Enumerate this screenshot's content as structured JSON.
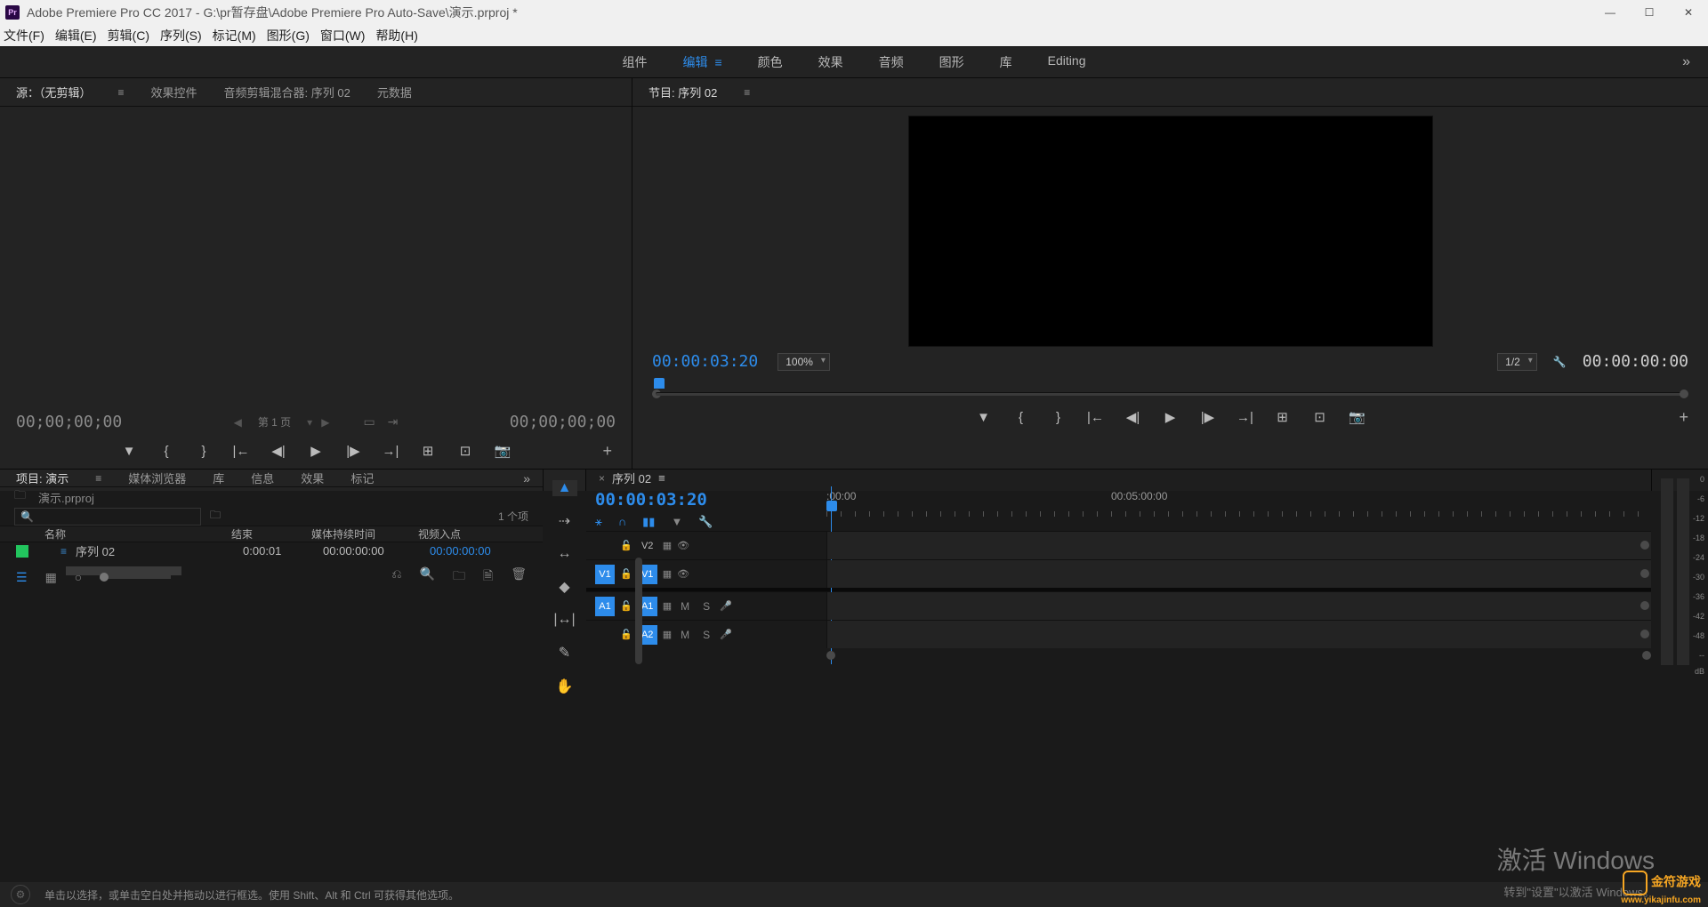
{
  "titlebar": {
    "app": "Adobe Premiere Pro CC 2017",
    "path": "G:\\pr暂存盘\\Adobe Premiere Pro Auto-Save\\演示.prproj *"
  },
  "menu": [
    "文件(F)",
    "编辑(E)",
    "剪辑(C)",
    "序列(S)",
    "标记(M)",
    "图形(G)",
    "窗口(W)",
    "帮助(H)"
  ],
  "workspaces": [
    "组件",
    "编辑",
    "颜色",
    "效果",
    "音频",
    "图形",
    "库",
    "Editing"
  ],
  "workspace_active": "编辑",
  "source": {
    "tabs": [
      "源：（无剪辑）",
      "效果控件",
      "音频剪辑混合器: 序列 02",
      "元数据"
    ],
    "left_tc": "00;00;00;00",
    "right_tc": "00;00;00;00",
    "pager_label": "第 1 页"
  },
  "program": {
    "title": "节目: 序列 02",
    "left_tc": "00:00:03:20",
    "zoom": "100%",
    "quality": "1/2",
    "right_tc": "00:00:00:00"
  },
  "project": {
    "tabs": [
      "项目: 演示",
      "媒体浏览器",
      "库",
      "信息",
      "效果",
      "标记"
    ],
    "filename": "演示.prproj",
    "count": "1 个项",
    "headers": {
      "name": "名称",
      "end": "结束",
      "media_duration": "媒体持续时间",
      "video_in": "视频入点"
    },
    "items": [
      {
        "name": "序列 02",
        "end": "0:00:01",
        "media_duration": "00:00:00:00",
        "video_in": "00:00:00:00"
      }
    ]
  },
  "timeline": {
    "name": "序列 02",
    "tc": "00:00:03:20",
    "ruler": {
      "start": ":00:00",
      "mark": "00:05:00:00"
    },
    "video_tracks": [
      {
        "patch": "",
        "label": "V2",
        "selected": false
      },
      {
        "patch": "V1",
        "label": "V1",
        "selected": true
      }
    ],
    "audio_tracks": [
      {
        "patch": "A1",
        "label": "A1",
        "selected": true
      },
      {
        "patch": "",
        "label": "A2",
        "selected": false,
        "a2blue": true
      }
    ]
  },
  "meters": {
    "marks": [
      "0",
      "-6",
      "-12",
      "-18",
      "-24",
      "-30",
      "-36",
      "-42",
      "-48",
      "--",
      "dB"
    ]
  },
  "footer": {
    "hint": "单击以选择，或单击空白处并拖动以进行框选。使用 Shift、Alt 和 Ctrl 可获得其他选项。"
  },
  "watermark": {
    "line1": "激活 Windows",
    "line2": "转到\"设置\"以激活 Windows。"
  },
  "brand": {
    "name": "金符游戏",
    "url": "www.yikajinfu.com"
  }
}
